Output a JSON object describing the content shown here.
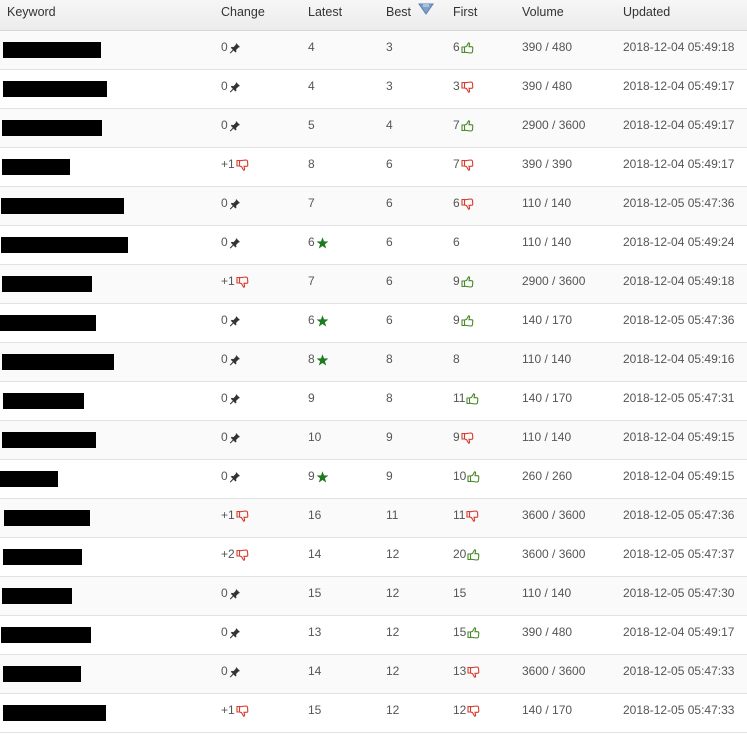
{
  "header": {
    "keyword": "Keyword",
    "change": "Change",
    "latest": "Latest",
    "best": "Best",
    "first": "First",
    "volume": "Volume",
    "updated": "Updated",
    "sort_icon": "sort-desc-arrow-icon"
  },
  "icons": {
    "none": "pin-icon",
    "down": "thumbs-down-icon",
    "up": "thumbs-up-icon",
    "star": "star-icon"
  },
  "colors": {
    "up": "#4a8a2a",
    "down": "#d83a2c",
    "star": "#1e7a1e",
    "pin": "#333333"
  },
  "rows": [
    {
      "change": "0",
      "change_icon": "pin",
      "latest": "4",
      "latest_icon": "",
      "best": "3",
      "first": "6",
      "first_icon": "up",
      "volume": "390 / 480",
      "updated": "2018-12-04 05:49:18"
    },
    {
      "change": "0",
      "change_icon": "pin",
      "latest": "4",
      "latest_icon": "",
      "best": "3",
      "first": "3",
      "first_icon": "down",
      "volume": "390 / 480",
      "updated": "2018-12-04 05:49:17"
    },
    {
      "change": "0",
      "change_icon": "pin",
      "latest": "5",
      "latest_icon": "",
      "best": "4",
      "first": "7",
      "first_icon": "up",
      "volume": "2900 / 3600",
      "updated": "2018-12-04 05:49:17"
    },
    {
      "change": "+1",
      "change_icon": "down",
      "latest": "8",
      "latest_icon": "",
      "best": "6",
      "first": "7",
      "first_icon": "down",
      "volume": "390 / 390",
      "updated": "2018-12-04 05:49:17"
    },
    {
      "change": "0",
      "change_icon": "pin",
      "latest": "7",
      "latest_icon": "",
      "best": "6",
      "first": "6",
      "first_icon": "down",
      "volume": "110 / 140",
      "updated": "2018-12-05 05:47:36"
    },
    {
      "change": "0",
      "change_icon": "pin",
      "latest": "6",
      "latest_icon": "star",
      "best": "6",
      "first": "6",
      "first_icon": "",
      "volume": "110 / 140",
      "updated": "2018-12-04 05:49:24"
    },
    {
      "change": "+1",
      "change_icon": "down",
      "latest": "7",
      "latest_icon": "",
      "best": "6",
      "first": "9",
      "first_icon": "up",
      "volume": "2900 / 3600",
      "updated": "2018-12-04 05:49:18"
    },
    {
      "change": "0",
      "change_icon": "pin",
      "latest": "6",
      "latest_icon": "star",
      "best": "6",
      "first": "9",
      "first_icon": "up",
      "volume": "140 / 170",
      "updated": "2018-12-05 05:47:36"
    },
    {
      "change": "0",
      "change_icon": "pin",
      "latest": "8",
      "latest_icon": "star",
      "best": "8",
      "first": "8",
      "first_icon": "",
      "volume": "110 / 140",
      "updated": "2018-12-04 05:49:16"
    },
    {
      "change": "0",
      "change_icon": "pin",
      "latest": "9",
      "latest_icon": "",
      "best": "8",
      "first": "11",
      "first_icon": "up",
      "volume": "140 / 170",
      "updated": "2018-12-05 05:47:31"
    },
    {
      "change": "0",
      "change_icon": "pin",
      "latest": "10",
      "latest_icon": "",
      "best": "9",
      "first": "9",
      "first_icon": "down",
      "volume": "110 / 140",
      "updated": "2018-12-04 05:49:15"
    },
    {
      "change": "0",
      "change_icon": "pin",
      "latest": "9",
      "latest_icon": "star",
      "best": "9",
      "first": "10",
      "first_icon": "up",
      "volume": "260 / 260",
      "updated": "2018-12-04 05:49:15"
    },
    {
      "change": "+1",
      "change_icon": "down",
      "latest": "16",
      "latest_icon": "",
      "best": "11",
      "first": "11",
      "first_icon": "down",
      "volume": "3600 / 3600",
      "updated": "2018-12-05 05:47:36"
    },
    {
      "change": "+2",
      "change_icon": "down",
      "latest": "14",
      "latest_icon": "",
      "best": "12",
      "first": "20",
      "first_icon": "up",
      "volume": "3600 / 3600",
      "updated": "2018-12-05 05:47:37"
    },
    {
      "change": "0",
      "change_icon": "pin",
      "latest": "15",
      "latest_icon": "",
      "best": "12",
      "first": "15",
      "first_icon": "",
      "volume": "110 / 140",
      "updated": "2018-12-05 05:47:30"
    },
    {
      "change": "0",
      "change_icon": "pin",
      "latest": "13",
      "latest_icon": "",
      "best": "12",
      "first": "15",
      "first_icon": "up",
      "volume": "390 / 480",
      "updated": "2018-12-04 05:49:17"
    },
    {
      "change": "0",
      "change_icon": "pin",
      "latest": "14",
      "latest_icon": "",
      "best": "12",
      "first": "13",
      "first_icon": "down",
      "volume": "3600 / 3600",
      "updated": "2018-12-05 05:47:33"
    },
    {
      "change": "+1",
      "change_icon": "down",
      "latest": "15",
      "latest_icon": "",
      "best": "12",
      "first": "12",
      "first_icon": "down",
      "volume": "140 / 170",
      "updated": "2018-12-05 05:47:33"
    }
  ]
}
